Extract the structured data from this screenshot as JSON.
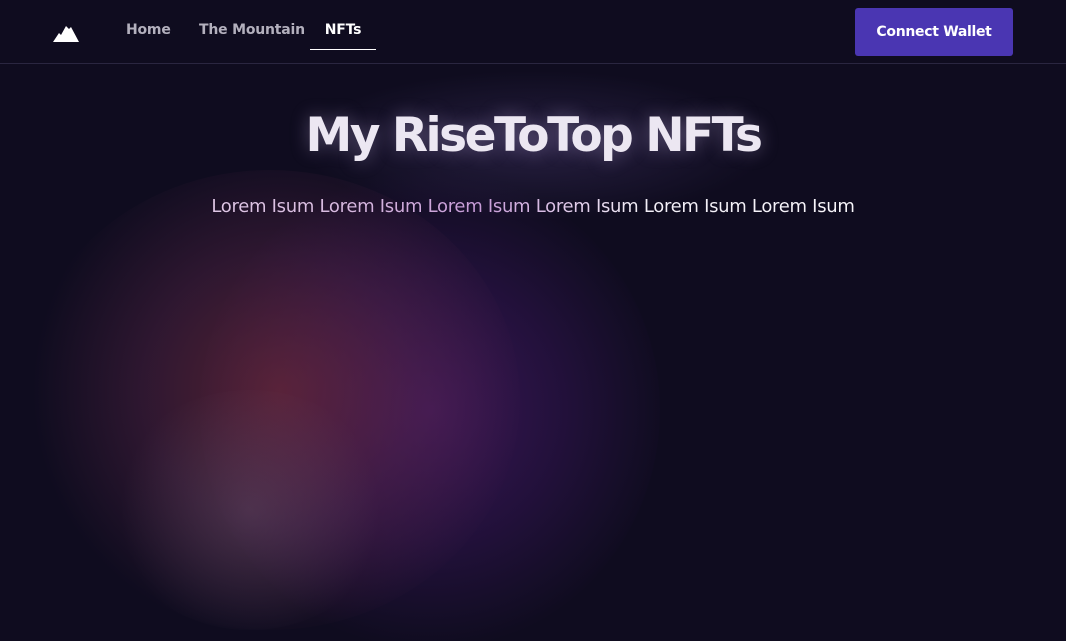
{
  "nav": {
    "logo_icon": "mountain-icon",
    "links": [
      {
        "label": "Home",
        "active": false
      },
      {
        "label": "The Mountain",
        "active": false
      },
      {
        "label": "NFTs",
        "active": true
      }
    ],
    "connect_label": "Connect Wallet"
  },
  "hero": {
    "title": "My RiseToTop NFTs",
    "subtitle": "Lorem Isum Lorem Isum Lorem Isum Lorem Isum Lorem Isum Lorem Isum"
  },
  "colors": {
    "background": "#0f0c1f",
    "accent": "#4a36b2",
    "nav_text": "#b3b0bd",
    "active_text": "#ffffff"
  }
}
